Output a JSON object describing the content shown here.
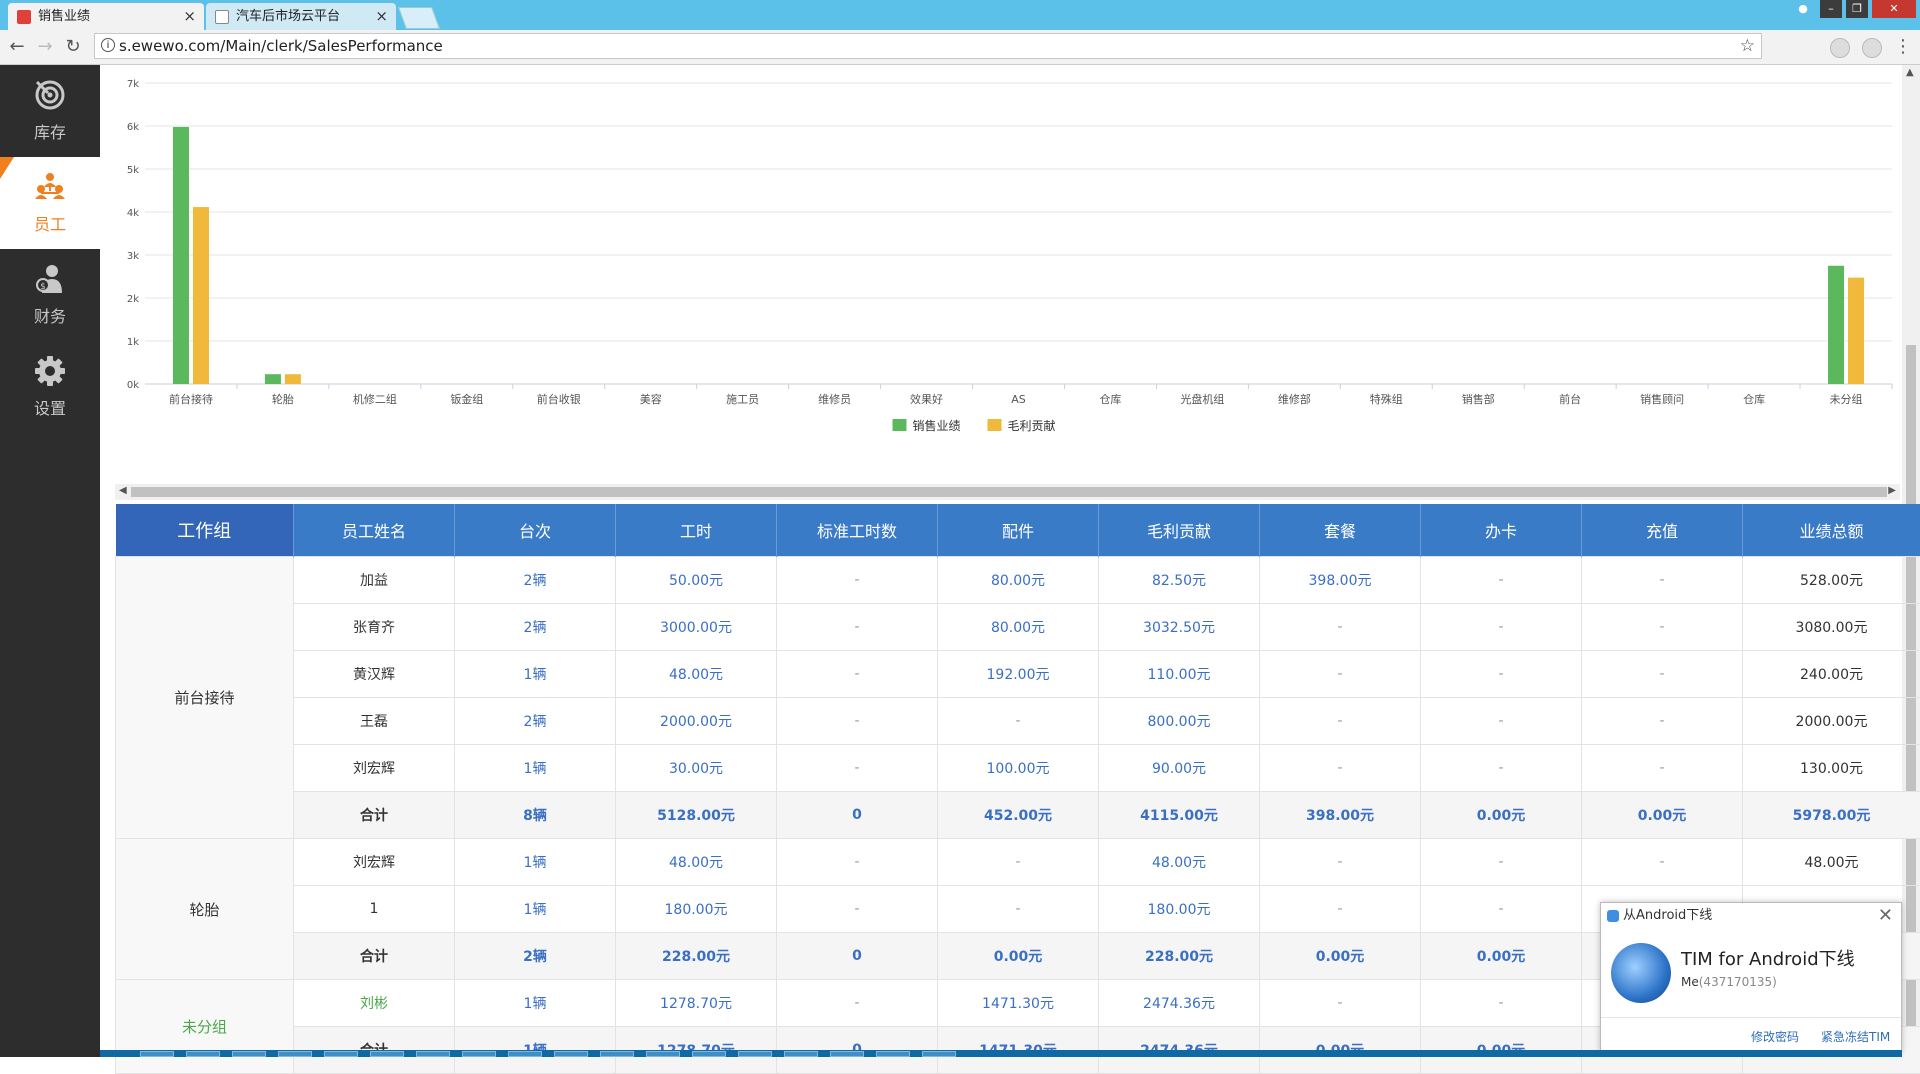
{
  "browser": {
    "tabs": [
      {
        "title": "销售业绩",
        "favicon_color": "#e0403a",
        "active": true
      },
      {
        "title": "汽车后市场云平台",
        "favicon_color": "#888888",
        "active": false
      }
    ],
    "url": "s.ewewo.com/Main/clerk/SalesPerformance",
    "window_buttons": [
      "user-icon",
      "minimize-icon",
      "restore-icon",
      "close-icon"
    ]
  },
  "sidebar": {
    "items": [
      {
        "label": "库存",
        "icon": "target-icon",
        "active": false
      },
      {
        "label": "员工",
        "icon": "people-icon",
        "active": true
      },
      {
        "label": "财务",
        "icon": "finance-person-icon",
        "active": false
      },
      {
        "label": "设置",
        "icon": "gear-icon",
        "active": false
      }
    ]
  },
  "chart_data": {
    "type": "bar",
    "categories": [
      "前台接待",
      "轮胎",
      "机修二组",
      "钣金组",
      "前台收银",
      "美容",
      "施工员",
      "维修员",
      "效果好",
      "AS",
      "仓库",
      "光盘机组",
      "维修部",
      "特殊组",
      "销售部",
      "前台",
      "销售顾问",
      "仓库",
      "未分组"
    ],
    "series": [
      {
        "name": "销售业绩",
        "color": "#5cb85c",
        "values": [
          5978,
          228,
          0,
          0,
          0,
          0,
          0,
          0,
          0,
          0,
          0,
          0,
          0,
          0,
          0,
          0,
          0,
          0,
          2750
        ]
      },
      {
        "name": "毛利贡献",
        "color": "#f0b93b",
        "values": [
          4115,
          228,
          0,
          0,
          0,
          0,
          0,
          0,
          0,
          0,
          0,
          0,
          0,
          0,
          0,
          0,
          0,
          0,
          2474.36
        ]
      }
    ],
    "yticks": [
      "0k",
      "1k",
      "2k",
      "3k",
      "4k",
      "5k",
      "6k",
      "7k"
    ],
    "ylim": [
      0,
      7000
    ],
    "grid": true,
    "legend_position": "bottom-center"
  },
  "table": {
    "headers": [
      "工作组",
      "员工姓名",
      "台次",
      "工时",
      "标准工时数",
      "配件",
      "毛利贡献",
      "套餐",
      "办卡",
      "充值",
      "业绩总额"
    ],
    "groups": [
      {
        "name": "前台接待",
        "green": false,
        "rows": [
          [
            "加益",
            "2辆",
            "50.00元",
            "-",
            "80.00元",
            "82.50元",
            "398.00元",
            "-",
            "-",
            "528.00元"
          ],
          [
            "张育齐",
            "2辆",
            "3000.00元",
            "-",
            "80.00元",
            "3032.50元",
            "-",
            "-",
            "-",
            "3080.00元"
          ],
          [
            "黄汉辉",
            "1辆",
            "48.00元",
            "-",
            "192.00元",
            "110.00元",
            "-",
            "-",
            "-",
            "240.00元"
          ],
          [
            "王磊",
            "2辆",
            "2000.00元",
            "-",
            "-",
            "800.00元",
            "-",
            "-",
            "-",
            "2000.00元"
          ],
          [
            "刘宏辉",
            "1辆",
            "30.00元",
            "-",
            "100.00元",
            "90.00元",
            "-",
            "-",
            "-",
            "130.00元"
          ]
        ],
        "total": [
          "合计",
          "8辆",
          "5128.00元",
          "0",
          "452.00元",
          "4115.00元",
          "398.00元",
          "0.00元",
          "0.00元",
          "5978.00元"
        ]
      },
      {
        "name": "轮胎",
        "green": false,
        "rows": [
          [
            "刘宏辉",
            "1辆",
            "48.00元",
            "-",
            "-",
            "48.00元",
            "-",
            "-",
            "-",
            "48.00元"
          ],
          [
            "1",
            "1辆",
            "180.00元",
            "-",
            "-",
            "180.00元",
            "-",
            "-",
            "-",
            "180.00元"
          ]
        ],
        "total": [
          "合计",
          "2辆",
          "228.00元",
          "0",
          "0.00元",
          "228.00元",
          "0.00元",
          "0.00元",
          "",
          ""
        ]
      },
      {
        "name": "未分组",
        "green": true,
        "rows": [
          [
            "刘彬",
            "1辆",
            "1278.70元",
            "-",
            "1471.30元",
            "2474.36元",
            "-",
            "-",
            "",
            ""
          ]
        ],
        "total": [
          "合计",
          "1辆",
          "1278.70元",
          "0",
          "1471.30元",
          "2474.36元",
          "0.00元",
          "0.00元",
          "",
          ""
        ]
      }
    ]
  },
  "popup": {
    "header": "从Android下线",
    "title": "TIM for Android下线",
    "subtitle_name": "Me",
    "subtitle_id": "(437170135)",
    "link_change_password": "修改密码",
    "link_freeze": "紧急冻结TIM"
  }
}
